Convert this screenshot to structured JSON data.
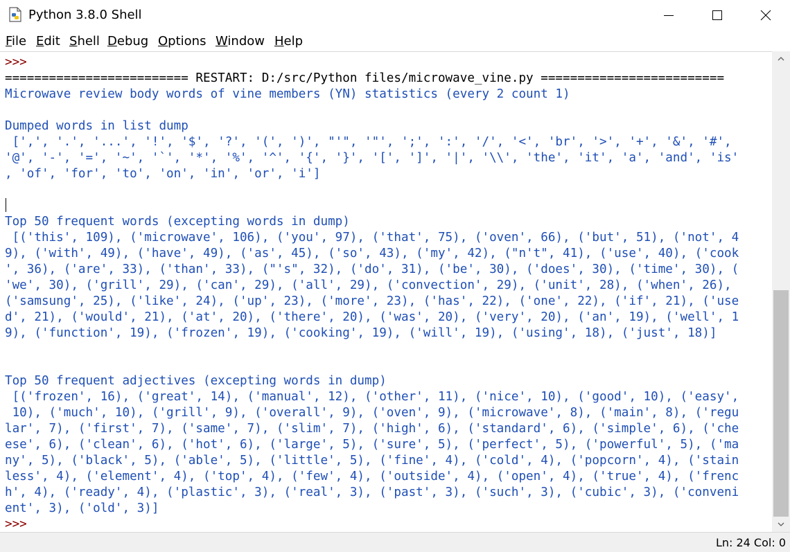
{
  "window": {
    "title": "Python 3.8.0 Shell",
    "icons": [
      "python-file-icon",
      "minimize-icon",
      "maximize-icon",
      "close-icon"
    ]
  },
  "menu": [
    {
      "key": "F",
      "rest": "ile"
    },
    {
      "key": "E",
      "rest": "dit"
    },
    {
      "key": "S",
      "rest": "hell"
    },
    {
      "key": "D",
      "rest": "ebug"
    },
    {
      "key": "O",
      "rest": "ptions"
    },
    {
      "key": "W",
      "rest": "indow"
    },
    {
      "key": "H",
      "rest": "elp"
    }
  ],
  "shell": {
    "lines": [
      {
        "kind": "prompt",
        "text": ">>>"
      },
      {
        "kind": "restart",
        "text": "========================= RESTART: D:/src/Python files/microwave_vine.py ========================="
      },
      {
        "kind": "stdout",
        "text": "Microwave review body words of vine members (YN) statistics (every 2 count 1)"
      },
      {
        "kind": "stdout",
        "text": ""
      },
      {
        "kind": "stdout",
        "text": "Dumped words in list dump"
      },
      {
        "kind": "stdout",
        "text": " [',', '.', '...', '!', '$', '?', '(', ')', \"'\", '\"', ';', ':', '/', '<', 'br', '>', '+', '&', '#',"
      },
      {
        "kind": "stdout",
        "text": "'@', '-', '=', '~', '`', '*', '%', '^', '{', '}', '[', ']', '|', '\\\\', 'the', 'it', 'a', 'and', 'is'"
      },
      {
        "kind": "stdout",
        "text": ", 'of', 'for', 'to', 'on', 'in', 'or', 'i']"
      },
      {
        "kind": "stdout",
        "text": ""
      },
      {
        "kind": "stdout",
        "text": ""
      },
      {
        "kind": "stdout",
        "text": "Top 50 frequent words (excepting words in dump)"
      },
      {
        "kind": "stdout",
        "text": " [('this', 109), ('microwave', 106), ('you', 97), ('that', 75), ('oven', 66), ('but', 51), ('not', 4"
      },
      {
        "kind": "stdout",
        "text": "9), ('with', 49), ('have', 49), ('as', 45), ('so', 43), ('my', 42), (\"n't\", 41), ('use', 40), ('cook"
      },
      {
        "kind": "stdout",
        "text": "', 36), ('are', 33), ('than', 33), (\"'s\", 32), ('do', 31), ('be', 30), ('does', 30), ('time', 30), ("
      },
      {
        "kind": "stdout",
        "text": "'we', 30), ('grill', 29), ('can', 29), ('all', 29), ('convection', 29), ('unit', 28), ('when', 26),"
      },
      {
        "kind": "stdout",
        "text": "('samsung', 25), ('like', 24), ('up', 23), ('more', 23), ('has', 22), ('one', 22), ('if', 21), ('use"
      },
      {
        "kind": "stdout",
        "text": "d', 21), ('would', 21), ('at', 20), ('there', 20), ('was', 20), ('very', 20), ('an', 19), ('well', 1"
      },
      {
        "kind": "stdout",
        "text": "9), ('function', 19), ('frozen', 19), ('cooking', 19), ('will', 19), ('using', 18), ('just', 18)]"
      },
      {
        "kind": "stdout",
        "text": ""
      },
      {
        "kind": "stdout",
        "text": ""
      },
      {
        "kind": "stdout",
        "text": "Top 50 frequent adjectives (excepting words in dump)"
      },
      {
        "kind": "stdout",
        "text": " [('frozen', 16), ('great', 14), ('manual', 12), ('other', 11), ('nice', 10), ('good', 10), ('easy',"
      },
      {
        "kind": "stdout",
        "text": " 10), ('much', 10), ('grill', 9), ('overall', 9), ('oven', 9), ('microwave', 8), ('main', 8), ('regu"
      },
      {
        "kind": "stdout",
        "text": "lar', 7), ('first', 7), ('same', 7), ('slim', 7), ('high', 6), ('standard', 6), ('simple', 6), ('che"
      },
      {
        "kind": "stdout",
        "text": "ese', 6), ('clean', 6), ('hot', 6), ('large', 5), ('sure', 5), ('perfect', 5), ('powerful', 5), ('ma"
      },
      {
        "kind": "stdout",
        "text": "ny', 5), ('black', 5), ('able', 5), ('little', 5), ('fine', 4), ('cold', 4), ('popcorn', 4), ('stain"
      },
      {
        "kind": "stdout",
        "text": "less', 4), ('element', 4), ('top', 4), ('few', 4), ('outside', 4), ('open', 4), ('true', 4), ('frenc"
      },
      {
        "kind": "stdout",
        "text": "h', 4), ('ready', 4), ('plastic', 3), ('real', 3), ('past', 3), ('such', 3), ('cubic', 3), ('conveni"
      },
      {
        "kind": "stdout",
        "text": "ent', 3), ('old', 3)]"
      },
      {
        "kind": "prompt",
        "text": ">>>"
      }
    ]
  },
  "status": {
    "text": "Ln: 24  Col: 0"
  }
}
